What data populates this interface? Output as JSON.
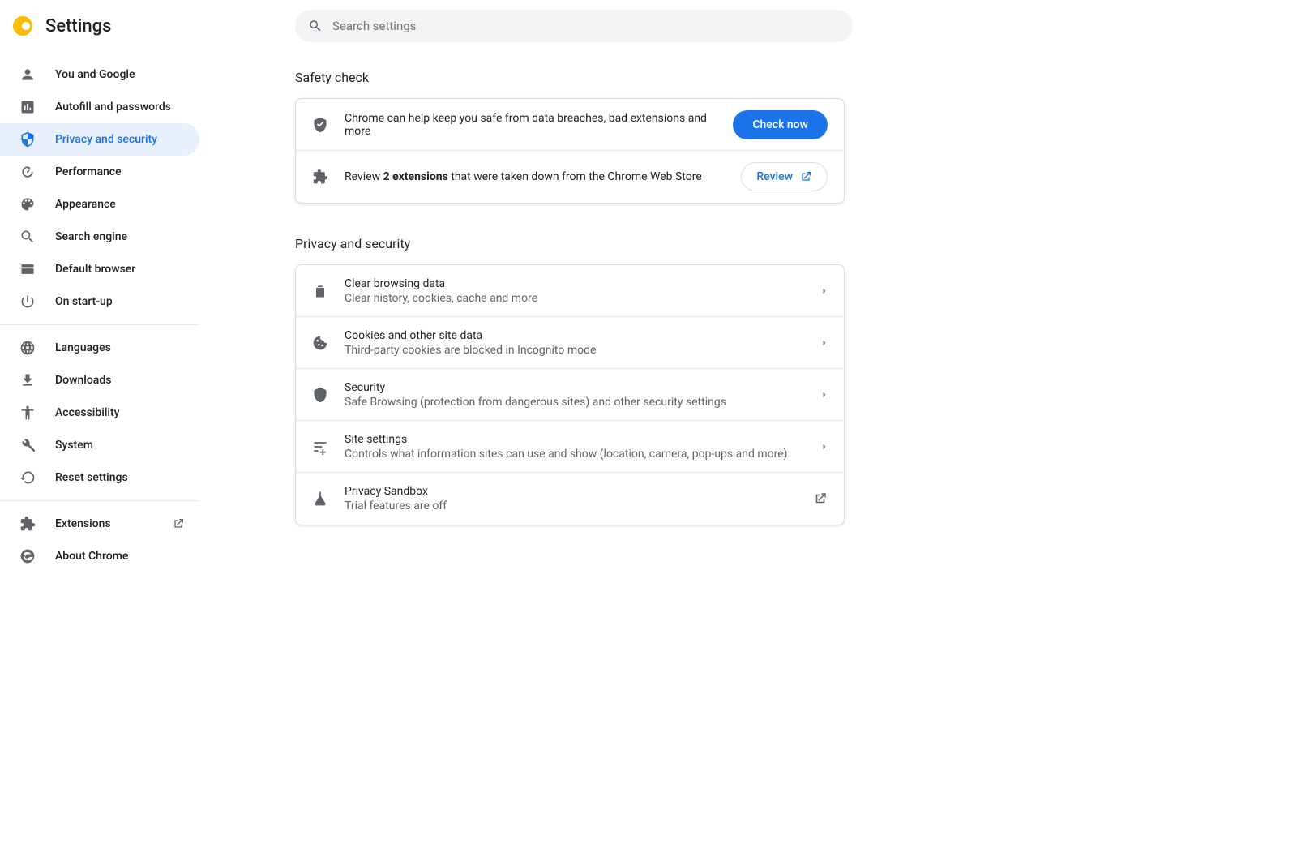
{
  "app_title": "Settings",
  "search": {
    "placeholder": "Search settings"
  },
  "sidebar": {
    "groups": [
      [
        {
          "label": "You and Google"
        },
        {
          "label": "Autofill and passwords"
        },
        {
          "label": "Privacy and security",
          "active": true
        },
        {
          "label": "Performance"
        },
        {
          "label": "Appearance"
        },
        {
          "label": "Search engine"
        },
        {
          "label": "Default browser"
        },
        {
          "label": "On start-up"
        }
      ],
      [
        {
          "label": "Languages"
        },
        {
          "label": "Downloads"
        },
        {
          "label": "Accessibility"
        },
        {
          "label": "System"
        },
        {
          "label": "Reset settings"
        }
      ],
      [
        {
          "label": "Extensions",
          "external": true
        },
        {
          "label": "About Chrome"
        }
      ]
    ]
  },
  "sections": {
    "safety_check": {
      "title": "Safety check",
      "row1": {
        "text": "Chrome can help keep you safe from data breaches, bad extensions and more",
        "button": "Check now"
      },
      "row2": {
        "prefix": "Review ",
        "bold": "2 extensions",
        "suffix": " that were taken down from the Chrome Web Store",
        "button": "Review"
      }
    },
    "privacy": {
      "title": "Privacy and security",
      "items": [
        {
          "title": "Clear browsing data",
          "sub": "Clear history, cookies, cache and more",
          "endicon": "chevron"
        },
        {
          "title": "Cookies and other site data",
          "sub": "Third-party cookies are blocked in Incognito mode",
          "endicon": "chevron"
        },
        {
          "title": "Security",
          "sub": "Safe Browsing (protection from dangerous sites) and other security settings",
          "endicon": "chevron"
        },
        {
          "title": "Site settings",
          "sub": "Controls what information sites can use and show (location, camera, pop-ups and more)",
          "endicon": "chevron"
        },
        {
          "title": "Privacy Sandbox",
          "sub": "Trial features are off",
          "endicon": "open"
        }
      ]
    }
  }
}
